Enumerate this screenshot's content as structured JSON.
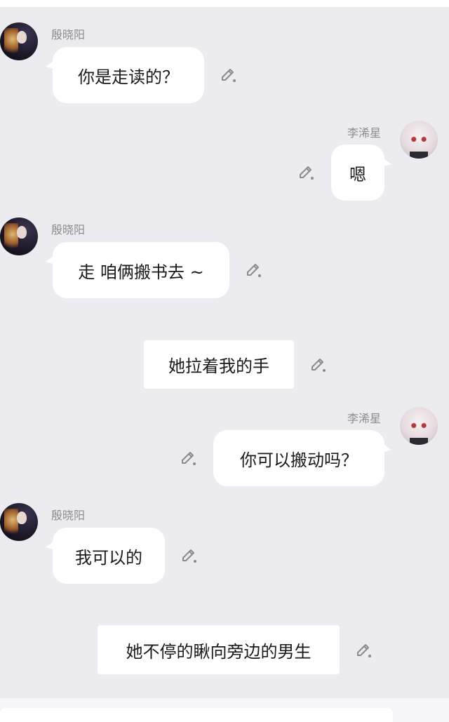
{
  "characters": {
    "left": {
      "name": "殷晓阳",
      "avatar_icon": "dark-haired-girl-avatar"
    },
    "right": {
      "name": "李浠星",
      "avatar_icon": "white-haired-girl-avatar"
    }
  },
  "messages": [
    {
      "type": "left",
      "sender": "殷晓阳",
      "text": "你是走读的？"
    },
    {
      "type": "right",
      "sender": "李浠星",
      "text": "嗯"
    },
    {
      "type": "left",
      "sender": "殷晓阳",
      "text": "走 咱俩搬书去 ~"
    },
    {
      "type": "narration",
      "text": "她拉着我的手"
    },
    {
      "type": "right",
      "sender": "李浠星",
      "text": "你可以搬动吗？"
    },
    {
      "type": "left",
      "sender": "殷晓阳",
      "text": "我可以的"
    },
    {
      "type": "narration",
      "text": "她不停的瞅向旁边的男生"
    }
  ],
  "icons": {
    "edit": "edit-pencil-icon"
  },
  "colors": {
    "chat_background": "#ececf0",
    "bubble": "#ffffff",
    "name_text": "#8a8a90",
    "message_text": "#1a1a1a",
    "icon": "#8a8a90"
  }
}
